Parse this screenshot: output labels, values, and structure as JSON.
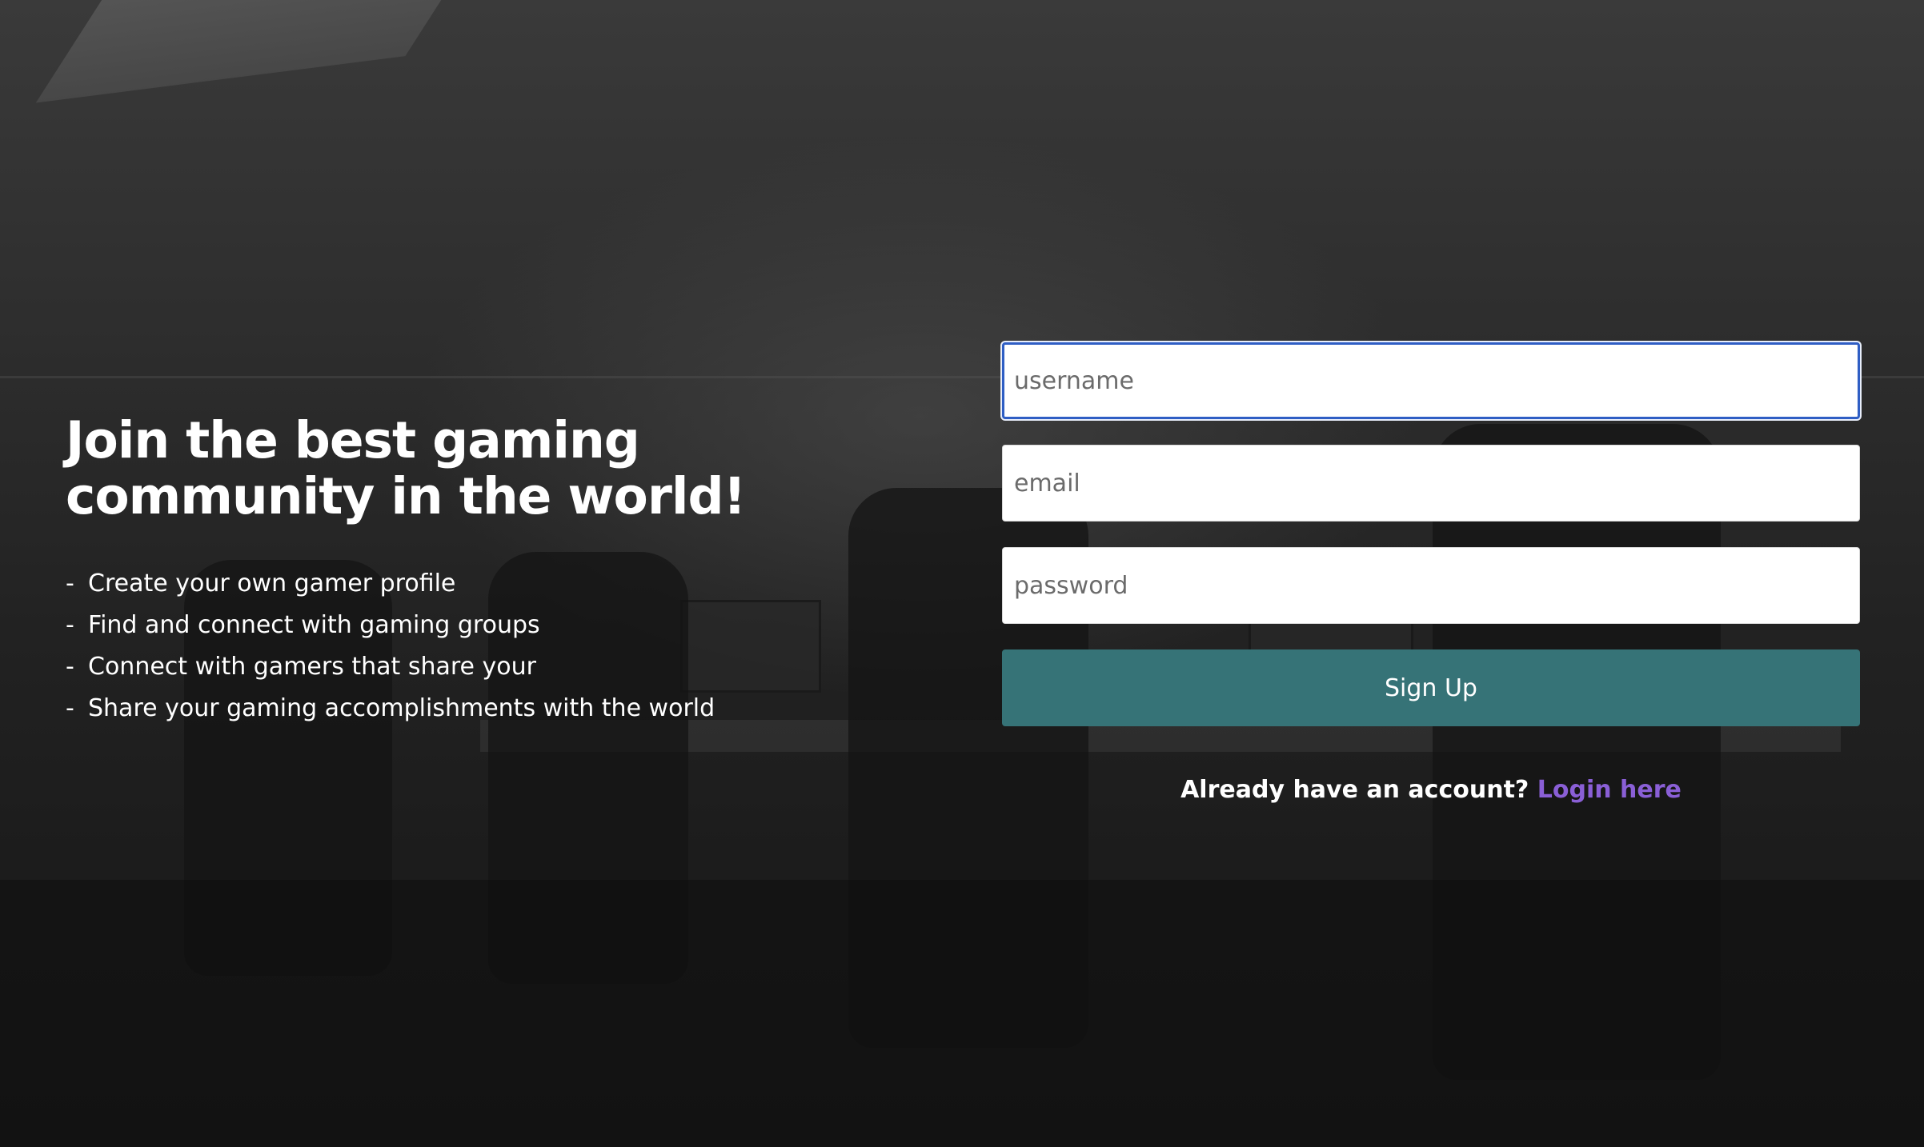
{
  "hero": {
    "headline": "Join the best gaming community in the world!",
    "features": [
      "Create your own gamer profile",
      "Find and connect with gaming groups",
      "Connect with gamers that share your",
      "Share your gaming accomplishments with the world"
    ],
    "bullet": "-"
  },
  "form": {
    "username": {
      "placeholder": "username",
      "value": ""
    },
    "email": {
      "placeholder": "email",
      "value": ""
    },
    "password": {
      "placeholder": "password",
      "value": ""
    },
    "submit_label": "Sign Up",
    "login_prompt": "Already have an account?",
    "login_link": "Login here"
  },
  "colors": {
    "button": "#367377",
    "link": "#8a5fd6",
    "focus_border": "#2f5ec4",
    "overlay": "#1e1e1e"
  }
}
